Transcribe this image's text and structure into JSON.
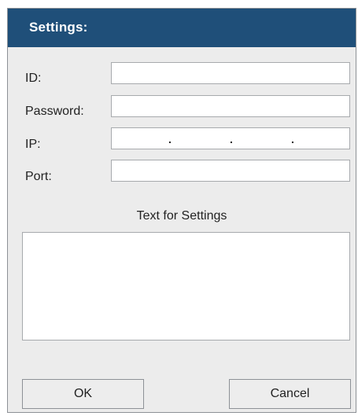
{
  "dialog": {
    "title": "Settings:"
  },
  "fields": {
    "id_label": "ID:",
    "id_value": "",
    "password_label": "Password:",
    "password_value": "",
    "ip_label": "IP:",
    "ip_octets": [
      "",
      "",
      "",
      ""
    ],
    "ip_separator": ".",
    "port_label": "Port:",
    "port_value": ""
  },
  "text_section": {
    "title": "Text for Settings",
    "value": ""
  },
  "buttons": {
    "ok_label": "OK",
    "cancel_label": "Cancel"
  },
  "colors": {
    "titlebar": "#1f4f79",
    "dialog_bg": "#ececec",
    "title_text": "#ffffff"
  }
}
